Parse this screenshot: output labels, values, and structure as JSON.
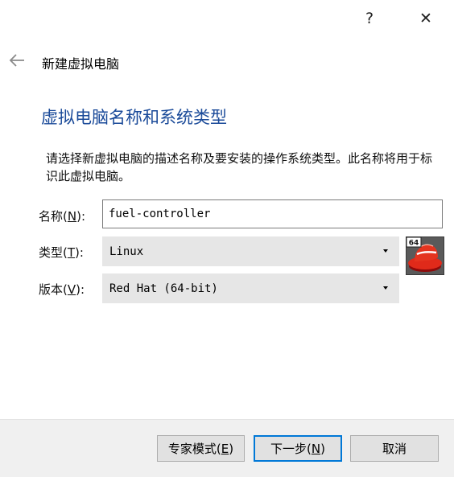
{
  "window": {
    "help_label": "?",
    "close_label": "✕"
  },
  "header": {
    "title": "新建虚拟电脑"
  },
  "page": {
    "heading": "虚拟电脑名称和系统类型",
    "description": "请选择新虚拟电脑的描述名称及要安装的操作系统类型。此名称将用于标识此虚拟电脑。"
  },
  "form": {
    "name": {
      "label_pre": "名称(",
      "mnemonic": "N",
      "label_post": "):",
      "value": "fuel-controller"
    },
    "type": {
      "label_pre": "类型(",
      "mnemonic": "T",
      "label_post": "):",
      "value": "Linux"
    },
    "version": {
      "label_pre": "版本(",
      "mnemonic": "V",
      "label_post": "):",
      "value": "Red Hat (64-bit)"
    },
    "os_icon": {
      "name": "redhat-64-icon",
      "badge": "64"
    }
  },
  "buttons": {
    "expert": {
      "label_pre": "专家模式(",
      "mnemonic": "E",
      "label_post": ")"
    },
    "next": {
      "label_pre": "下一步(",
      "mnemonic": "N",
      "label_post": ")"
    },
    "cancel": {
      "label": "取消"
    }
  },
  "colors": {
    "heading": "#1a4a99",
    "focus_border": "#0078d7",
    "footer_bg": "#f0f0f0"
  }
}
